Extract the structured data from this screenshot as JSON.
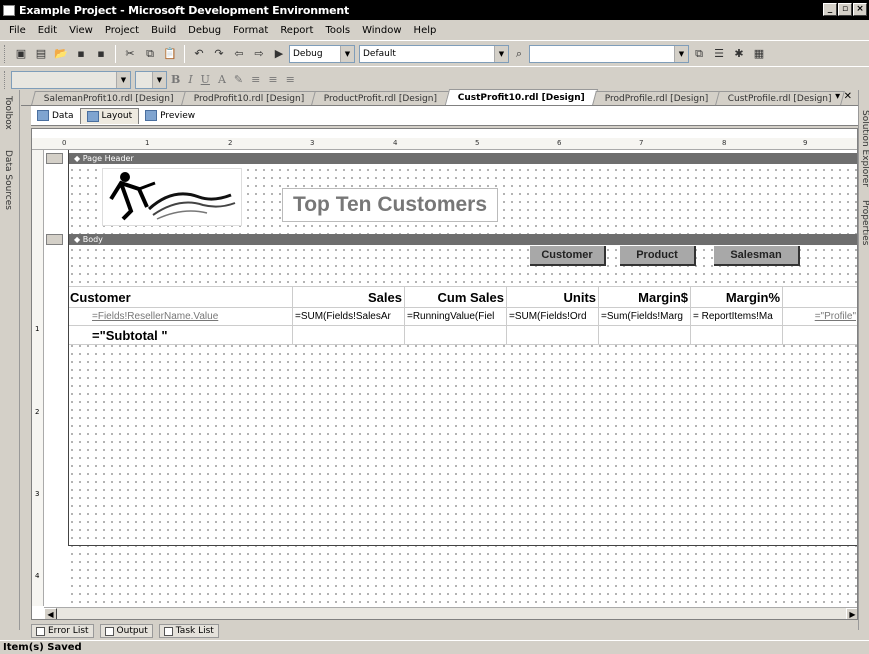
{
  "window": {
    "title": "Example Project - Microsoft Development Environment"
  },
  "menu": [
    "File",
    "Edit",
    "View",
    "Project",
    "Build",
    "Debug",
    "Format",
    "Report",
    "Tools",
    "Window",
    "Help"
  ],
  "toolbar": {
    "config": "Debug",
    "platform": "Default"
  },
  "left_panels": [
    "Toolbox",
    "Data Sources"
  ],
  "right_panels": [
    "Solution Explorer",
    "Properties"
  ],
  "doc_tabs": [
    "SalemanProfit10.rdl [Design]",
    "ProdProfit10.rdl [Design]",
    "ProductProfit.rdl [Design]",
    "CustProfit10.rdl [Design]",
    "ProdProfile.rdl [Design]",
    "CustProfile.rdl [Design]"
  ],
  "active_doc_tab": "CustProfit10.rdl [Design]",
  "design_tabs": [
    "Data",
    "Layout",
    "Preview"
  ],
  "ruler": [
    "0",
    "1",
    "2",
    "3",
    "4",
    "5",
    "6",
    "7",
    "8",
    "9"
  ],
  "vruler": [
    "1",
    "2",
    "3",
    "4"
  ],
  "report": {
    "page_header_label": "Page Header",
    "body_label": "Body",
    "title": "Top Ten Customers",
    "buttons": [
      "Customer",
      "Product",
      "Salesman"
    ],
    "table": {
      "headers": [
        "Customer",
        "Sales",
        "Cum Sales",
        "Units",
        "Margin$",
        "Margin%",
        ""
      ],
      "detail": [
        "=Fields!ResellerName.Value",
        "=SUM(Fields!SalesAr",
        "=RunningValue(Fiel",
        "=SUM(Fields!Ord",
        "=Sum(Fields!Marg",
        "= ReportItems!Ma",
        "=\"Profile\""
      ],
      "subtotal": "=\"Subtotal \""
    }
  },
  "bottom_tabs": [
    "Error List",
    "Output",
    "Task List"
  ],
  "status": "Item(s) Saved"
}
